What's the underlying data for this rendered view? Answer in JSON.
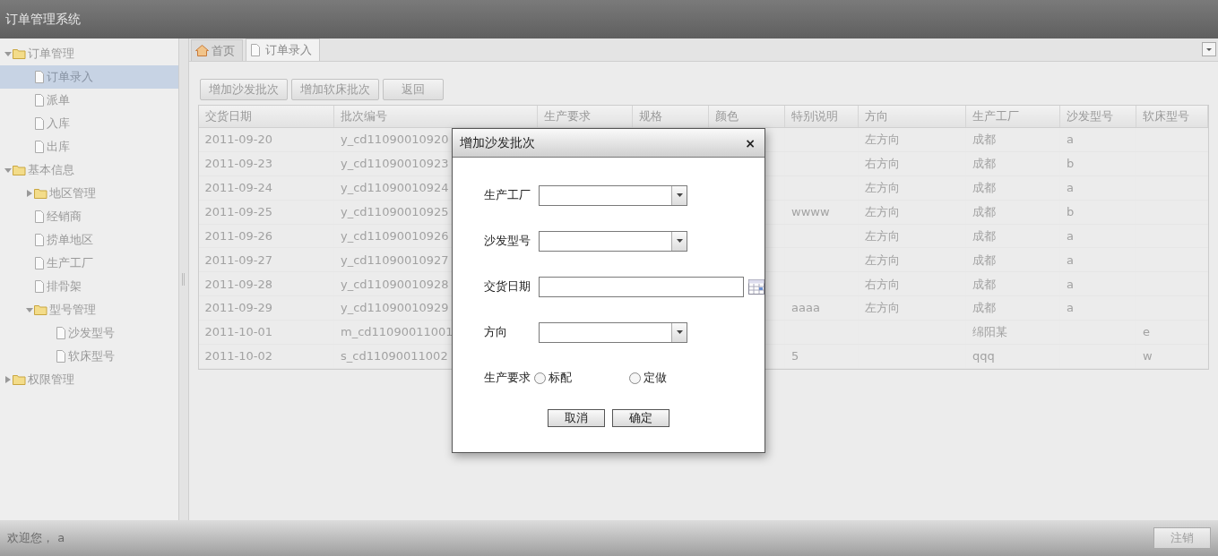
{
  "app": {
    "title": "订单管理系统"
  },
  "sidebar": {
    "items": [
      {
        "label": "订单管理",
        "kind": "folder",
        "expanded": true,
        "selected": false,
        "children": [
          {
            "label": "订单录入",
            "kind": "file",
            "selected": true
          },
          {
            "label": "派单",
            "kind": "file",
            "selected": false
          },
          {
            "label": "入库",
            "kind": "file",
            "selected": false
          },
          {
            "label": "出库",
            "kind": "file",
            "selected": false
          }
        ]
      },
      {
        "label": "基本信息",
        "kind": "folder",
        "expanded": true,
        "selected": false,
        "children": [
          {
            "label": "地区管理",
            "kind": "folder",
            "expanded": false,
            "selected": false
          },
          {
            "label": "经销商",
            "kind": "file",
            "selected": false
          },
          {
            "label": "捞单地区",
            "kind": "file",
            "selected": false
          },
          {
            "label": "生产工厂",
            "kind": "file",
            "selected": false
          },
          {
            "label": "排骨架",
            "kind": "file",
            "selected": false
          },
          {
            "label": "型号管理",
            "kind": "folder",
            "expanded": true,
            "selected": false,
            "children": [
              {
                "label": "沙发型号",
                "kind": "file",
                "selected": false
              },
              {
                "label": "软床型号",
                "kind": "file",
                "selected": false
              }
            ]
          }
        ]
      },
      {
        "label": "权限管理",
        "kind": "folder",
        "expanded": false,
        "selected": false
      }
    ]
  },
  "tabs": [
    {
      "label": "首页",
      "kind": "home",
      "selected": false
    },
    {
      "label": "订单录入",
      "kind": "file",
      "selected": true
    }
  ],
  "toolbar": [
    "增加沙发批次",
    "增加软床批次",
    "返回"
  ],
  "table": {
    "columns": [
      "交货日期",
      "批次编号",
      "生产要求",
      "规格",
      "颜色",
      "特别说明",
      "方向",
      "生产工厂",
      "沙发型号",
      "软床型号"
    ],
    "rows": [
      {
        "date": "2011-09-20",
        "batch": "y_cd11090010920",
        "direction": "左方向",
        "factory": "成都",
        "sofa_model": "a"
      },
      {
        "date": "2011-09-23",
        "batch": "y_cd11090010923",
        "direction": "右方向",
        "factory": "成都",
        "sofa_model": "b"
      },
      {
        "date": "2011-09-24",
        "batch": "y_cd11090010924",
        "direction": "左方向",
        "factory": "成都",
        "sofa_model": "a"
      },
      {
        "date": "2011-09-25",
        "batch": "y_cd11090010925",
        "special": "wwww",
        "direction": "左方向",
        "factory": "成都",
        "sofa_model": "b"
      },
      {
        "date": "2011-09-26",
        "batch": "y_cd11090010926",
        "direction": "左方向",
        "factory": "成都",
        "sofa_model": "a"
      },
      {
        "date": "2011-09-27",
        "batch": "y_cd11090010927",
        "direction": "左方向",
        "factory": "成都",
        "sofa_model": "a"
      },
      {
        "date": "2011-09-28",
        "batch": "y_cd11090010928",
        "direction": "右方向",
        "factory": "成都",
        "sofa_model": "a"
      },
      {
        "date": "2011-09-29",
        "batch": "y_cd11090010929",
        "special": "aaaa",
        "direction": "左方向",
        "factory": "成都",
        "sofa_model": "a"
      },
      {
        "date": "2011-10-01",
        "batch": "m_cd11090011001",
        "factory": "绵阳某",
        "bed_model": "e"
      },
      {
        "date": "2011-10-02",
        "batch": "s_cd11090011002",
        "special": "5",
        "factory": "qqq",
        "bed_model": "w"
      }
    ]
  },
  "dialog": {
    "title": "增加沙发批次",
    "close": "×",
    "fields": [
      {
        "label": "生产工厂",
        "kind": "select"
      },
      {
        "label": "沙发型号",
        "kind": "select"
      },
      {
        "label": "交货日期",
        "kind": "date"
      },
      {
        "label": "方向",
        "kind": "select"
      }
    ],
    "radio_label": "生产要求",
    "options": [
      {
        "label": "标配",
        "checked": false
      },
      {
        "label": "定做",
        "checked": false
      }
    ],
    "buttons": [
      "取消",
      "确定"
    ]
  },
  "footer": {
    "welcome": "欢迎您， a",
    "logout": "注销"
  }
}
